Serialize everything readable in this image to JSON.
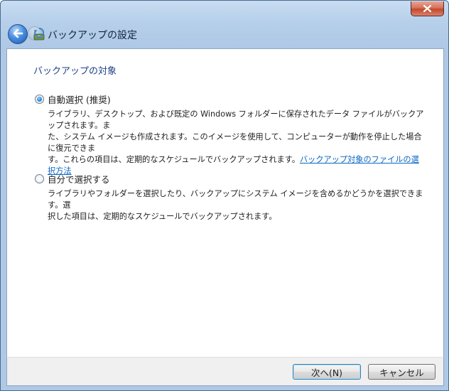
{
  "window": {
    "title": "バックアップの設定",
    "close_glyph": "x"
  },
  "section": {
    "heading": "バックアップの対象"
  },
  "options": [
    {
      "label": "自動選択 (推奨)",
      "checked": true,
      "description_lines": [
        "ライブラリ、デスクトップ、および既定の Windows フォルダーに保存されたデータ ファイルがバックアップされます。ま",
        "た、システム イメージも作成されます。このイメージを使用して、コンピューターが動作を停止した場合に復元できま",
        "す。これらの項目は、定期的なスケジュールでバックアップされます。"
      ],
      "link_text": "バックアップ対象のファイルの選択方法"
    },
    {
      "label": "自分で選択する",
      "checked": false,
      "description_lines": [
        "ライブラリやフォルダーを選択したり、バックアップにシステム イメージを含めるかどうかを選択できます。選",
        "択した項目は、定期的なスケジュールでバックアップされます。"
      ]
    }
  ],
  "buttons": {
    "next": "次へ(N)",
    "cancel": "キャンセル"
  },
  "icons": {
    "back": "back-arrow-icon",
    "forward": "forward-arrow-icon",
    "title": "backup-icon",
    "close": "close-icon"
  }
}
